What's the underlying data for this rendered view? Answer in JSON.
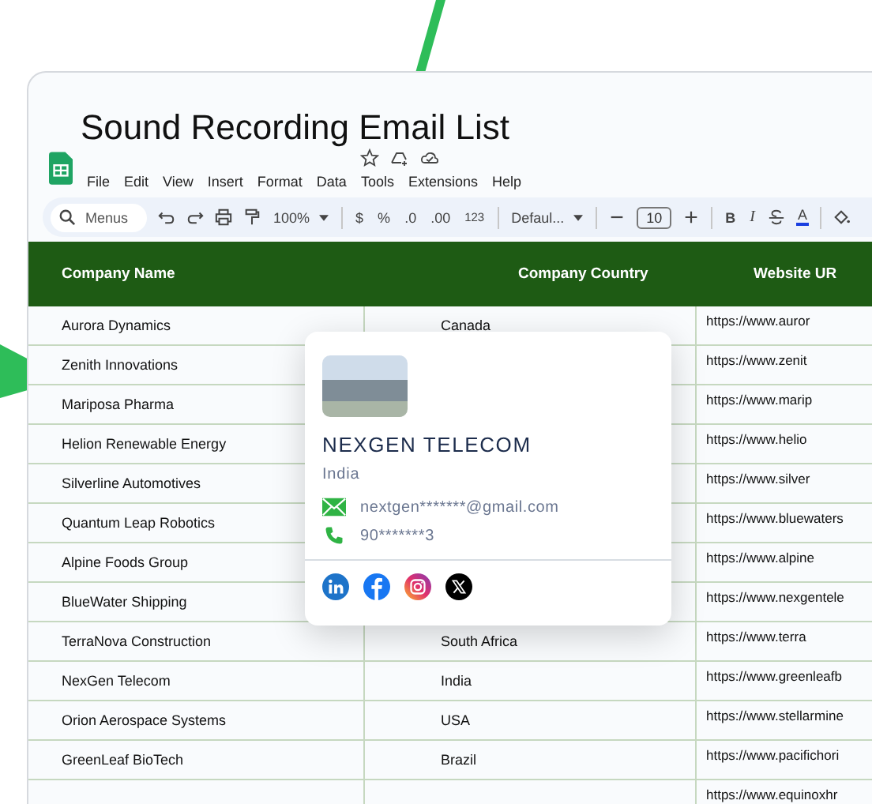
{
  "document": {
    "title": "Sound Recording Email List"
  },
  "menu": [
    "File",
    "Edit",
    "View",
    "Insert",
    "Format",
    "Data",
    "Tools",
    "Extensions",
    "Help"
  ],
  "toolbar": {
    "search_placeholder": "Menus",
    "zoom": "100%",
    "currency": "$",
    "percent": "%",
    "decrease_decimal": ".0",
    "increase_decimal": ".00",
    "number_format": "123",
    "font": "Defaul...",
    "font_size": "10",
    "bold": "B",
    "italic": "I",
    "text_color": "A"
  },
  "table": {
    "columns": [
      "Company Name",
      "Company Country",
      "Website UR"
    ],
    "rows": [
      {
        "name": "Aurora Dynamics",
        "country": "Canada",
        "website": "https://www.auror"
      },
      {
        "name": "Zenith Innovations",
        "country": "",
        "website": "https://www.zenit"
      },
      {
        "name": "Mariposa Pharma",
        "country": "",
        "website": "https://www.marip"
      },
      {
        "name": "Helion Renewable Energy",
        "country": "",
        "website": "https://www.helio"
      },
      {
        "name": "Silverline Automotives",
        "country": "",
        "website": "https://www.silver"
      },
      {
        "name": "Quantum Leap Robotics",
        "country": "",
        "website": "https://www.bluewaters"
      },
      {
        "name": "Alpine Foods Group",
        "country": "",
        "website": "https://www.alpine"
      },
      {
        "name": "BlueWater Shipping",
        "country": "",
        "website": "https://www.nexgentele"
      },
      {
        "name": "TerraNova Construction",
        "country": "South Africa",
        "website": "https://www.terra"
      },
      {
        "name": "NexGen Telecom",
        "country": "India",
        "website": "https://www.greenleafb"
      },
      {
        "name": "Orion Aerospace Systems",
        "country": "USA",
        "website": "https://www.stellarmine"
      },
      {
        "name": "GreenLeaf BioTech",
        "country": "Brazil",
        "website": "https://www.pacifichori"
      },
      {
        "name": "",
        "country": "",
        "website": "https://www.equinoxhr"
      }
    ]
  },
  "popup_card": {
    "company": "NEXGEN TELECOM",
    "country": "India",
    "email": "nextgen*******@gmail.com",
    "phone": "90*******3"
  }
}
